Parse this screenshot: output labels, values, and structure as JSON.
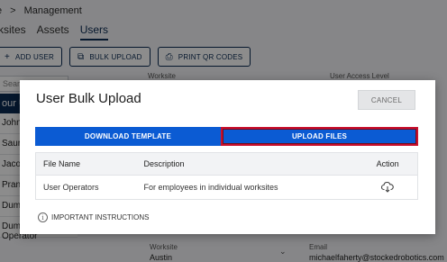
{
  "breadcrumb": {
    "home": "e",
    "separator": ">",
    "current": "Management"
  },
  "tabs": {
    "worksites": "rksites",
    "assets": "Assets",
    "users": "Users"
  },
  "toolbar": {
    "add_user": "ADD USER",
    "bulk_upload": "BULK UPLOAD",
    "print_qr": "PRINT QR CODES"
  },
  "search": {
    "placeholder": "Search Users"
  },
  "sidebar": {
    "header": "our Users",
    "items": [
      {
        "label": "John"
      },
      {
        "label": "Saura"
      },
      {
        "label": "Jacob"
      },
      {
        "label": "Prana"
      },
      {
        "label": "Dumm"
      },
      {
        "label": "Dummy Operator"
      }
    ]
  },
  "columns": {
    "worksite": "Worksite",
    "access": "User Access Level"
  },
  "detail": {
    "worksite_label": "Worksite",
    "worksite_value": "Austin",
    "email_label": "Email",
    "email_value": "michaelfaherty@stockedrobotics.com"
  },
  "modal": {
    "title": "User Bulk Upload",
    "cancel": "CANCEL",
    "download_template": "DOWNLOAD TEMPLATE",
    "upload_files": "UPLOAD FILES",
    "table": {
      "headers": {
        "file_name": "File Name",
        "description": "Description",
        "action": "Action"
      },
      "rows": [
        {
          "file_name": "User Operators",
          "description": "For employees in individual worksites",
          "action_icon": "cloud-download-icon"
        }
      ]
    },
    "instructions": "IMPORTANT INSTRUCTIONS"
  },
  "colors": {
    "primary": "#0b5bd3",
    "navy": "#0a2a52",
    "highlight_border": "#c8102e"
  }
}
